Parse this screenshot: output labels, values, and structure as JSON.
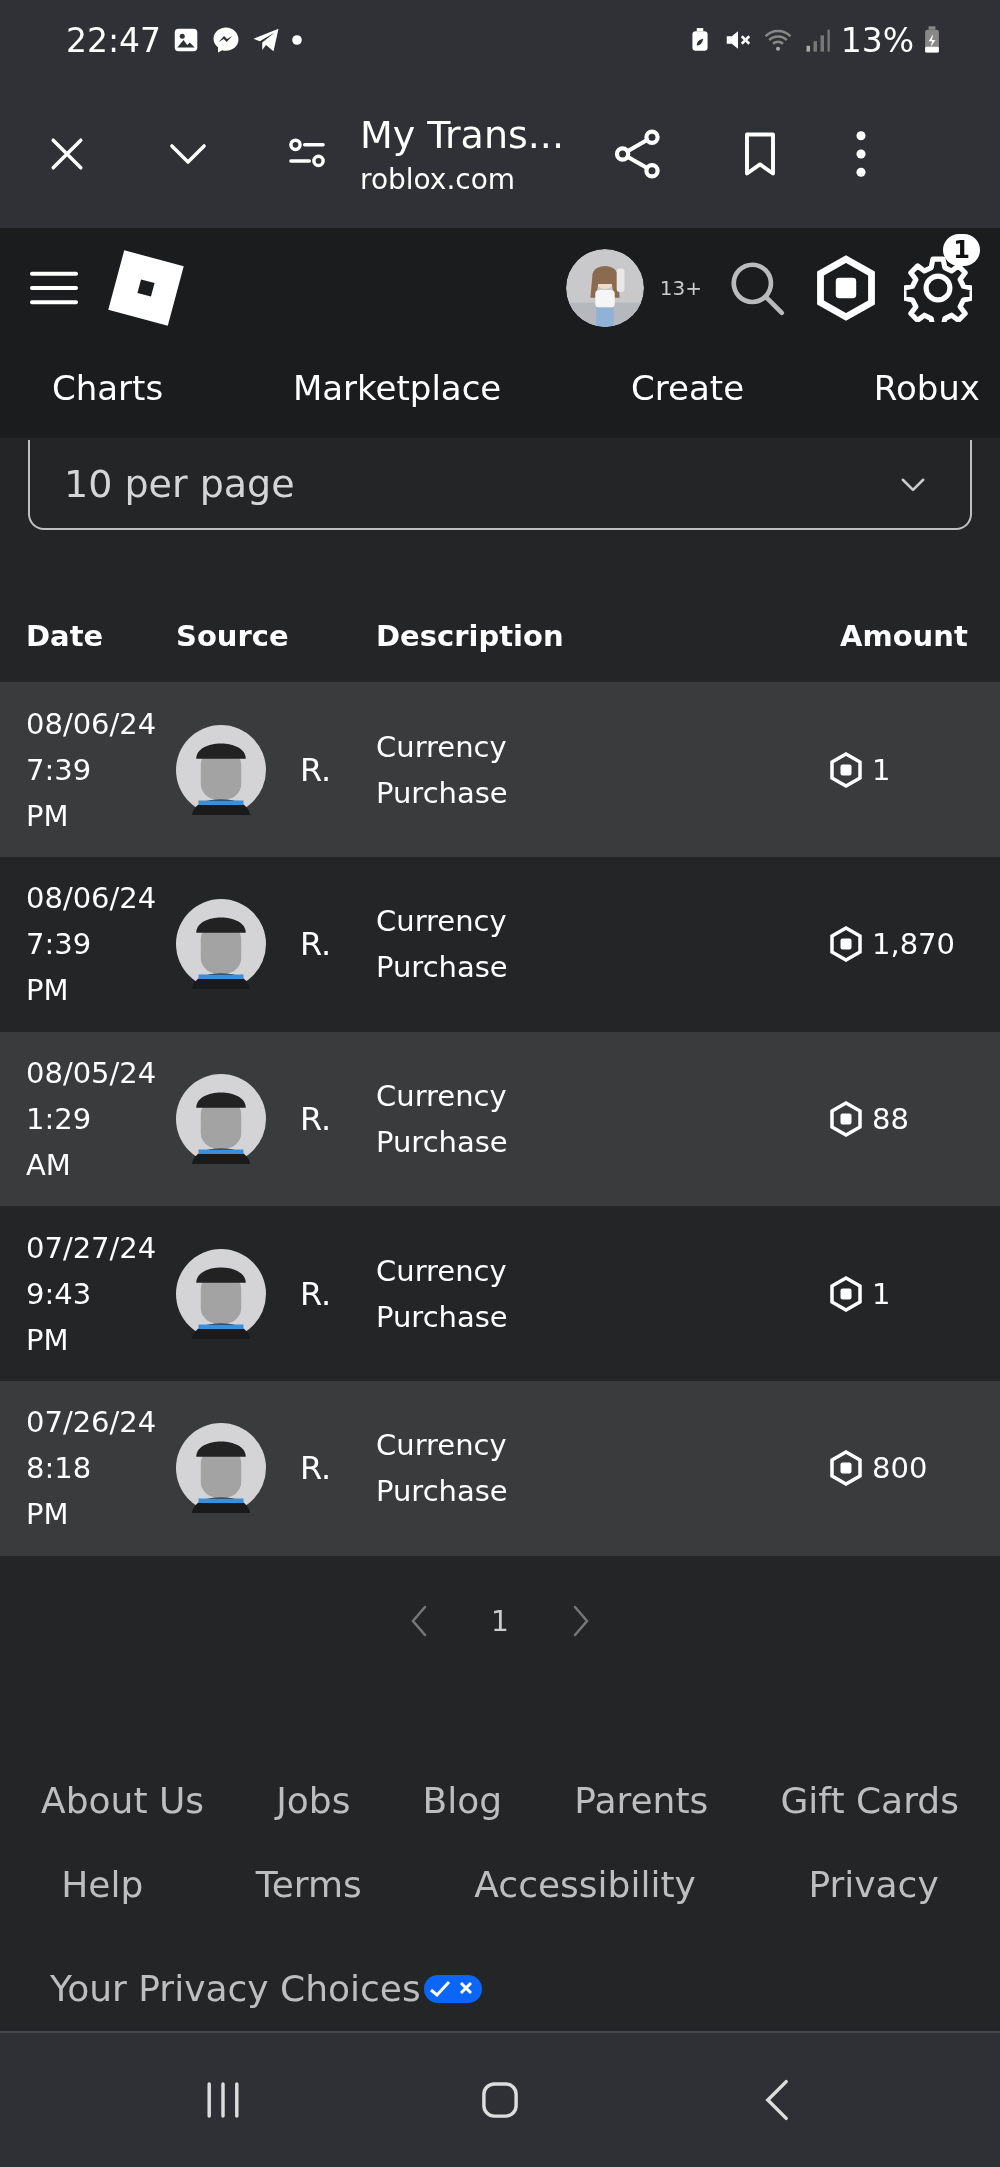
{
  "status_bar": {
    "time": "22:47",
    "battery": "13%"
  },
  "browser": {
    "title": "My Trans...",
    "url": "roblox.com"
  },
  "header": {
    "age_badge": "13+",
    "notification_count": "1"
  },
  "nav_tabs": [
    {
      "label": "Charts"
    },
    {
      "label": "Marketplace"
    },
    {
      "label": "Create"
    },
    {
      "label": "Robux"
    }
  ],
  "page_size": {
    "value": "10 per page"
  },
  "table": {
    "columns": [
      "Date",
      "Source",
      "Description",
      "Amount"
    ],
    "rows": [
      {
        "date": "08/06/24",
        "time": "7:39 PM",
        "source": "R.",
        "description": "Currency Purchase",
        "amount": "1"
      },
      {
        "date": "08/06/24",
        "time": "7:39 PM",
        "source": "R.",
        "description": "Currency Purchase",
        "amount": "1,870"
      },
      {
        "date": "08/05/24",
        "time": "1:29 AM",
        "source": "R.",
        "description": "Currency Purchase",
        "amount": "88"
      },
      {
        "date": "07/27/24",
        "time": "9:43 PM",
        "source": "R.",
        "description": "Currency Purchase",
        "amount": "1"
      },
      {
        "date": "07/26/24",
        "time": "8:18 PM",
        "source": "R.",
        "description": "Currency Purchase",
        "amount": "800"
      }
    ]
  },
  "pagination": {
    "page": "1"
  },
  "footer": {
    "links": [
      "About Us",
      "Jobs",
      "Blog",
      "Parents",
      "Gift Cards",
      "Help",
      "Terms",
      "Accessibility",
      "Privacy"
    ],
    "privacy_choices": "Your Privacy Choices"
  }
}
